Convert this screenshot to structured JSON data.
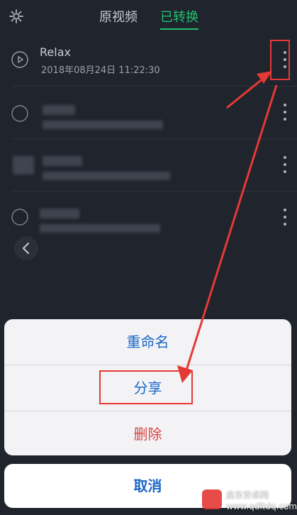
{
  "header": {
    "tabs": [
      {
        "label": "原视频"
      },
      {
        "label": "已转换"
      }
    ]
  },
  "list": {
    "items": [
      {
        "title": "Relax",
        "datetime": "2018年08月24日 11:22:30"
      }
    ]
  },
  "action_sheet": {
    "rename_label": "重命名",
    "share_label": "分享",
    "delete_label": "删除",
    "cancel_label": "取消"
  },
  "watermark": {
    "line1": "启东安卓网",
    "line2": "www.qdltdq.com"
  },
  "colors": {
    "accent": "#22c06f",
    "action_blue": "#1b67c6",
    "danger": "#d64545",
    "annotation_red": "#e53935"
  }
}
